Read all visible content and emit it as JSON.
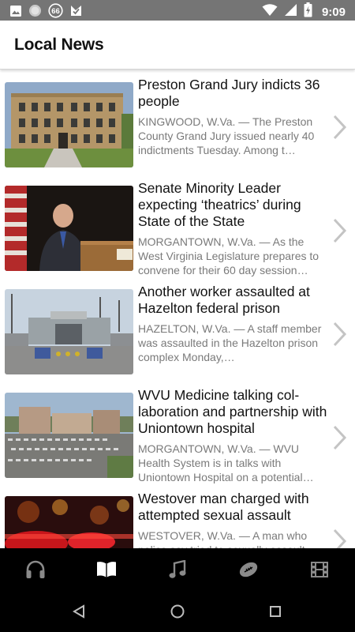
{
  "status_bar": {
    "time": "9:09",
    "left_icons": [
      "image-icon",
      "circle-icon",
      "badge-66-icon",
      "check-download-icon"
    ],
    "badge_text": "66",
    "right_icons": [
      "wifi-icon",
      "signal-icon",
      "battery-charging-icon"
    ]
  },
  "app_bar": {
    "title": "Local News"
  },
  "news": [
    {
      "title": "Preston Grand Jury indicts 36 people",
      "snippet": "KINGWOOD, W.Va. — The Preston County Grand Jury issued nearly 40 indictments  Tuesday. Among t…",
      "image": "courthouse-building-photo"
    },
    {
      "title": "Senate Minority Leader expecting ‘theatrics’ during State of the State",
      "snippet": "MORGANTOWN, W.Va. — As the West Virginia Legislature prepares to convene for their 60 day session…",
      "image": "speaker-at-podium-photo"
    },
    {
      "title": "Another worker assaulted at Hazelton federal prison",
      "snippet": "HAZELTON, W.Va. — A staff member was assaulted in the Hazelton prison complex Monday,…",
      "image": "prison-entrance-photo"
    },
    {
      "title": "WVU Medicine talking col-laboration and partnership with Uniontown hospital",
      "snippet": "MORGANTOWN, W.Va. — WVU Health System is in talks with Uniontown Hospital on a potential…",
      "image": "hospital-aerial-photo"
    },
    {
      "title": "Westover man charged with attempted sexual assault",
      "snippet": "WESTOVER, W.Va. — A man who police say tried to sexually assault…",
      "image": "police-lights-photo"
    }
  ],
  "tabs": [
    {
      "icon": "headphones-icon",
      "active": false
    },
    {
      "icon": "open-book-icon",
      "active": true
    },
    {
      "icon": "music-note-icon",
      "active": false
    },
    {
      "icon": "football-icon",
      "active": false
    },
    {
      "icon": "film-strip-icon",
      "active": false
    }
  ],
  "nav_bar": {
    "buttons": [
      "back-triangle-icon",
      "home-circle-icon",
      "recents-square-icon"
    ]
  },
  "colors": {
    "status_bar": "#757575",
    "tab_active": "#ffffff",
    "tab_inactive": "#8a8a8a",
    "chevron": "#c4c4c4",
    "snippet_text": "#7a7a7a"
  }
}
